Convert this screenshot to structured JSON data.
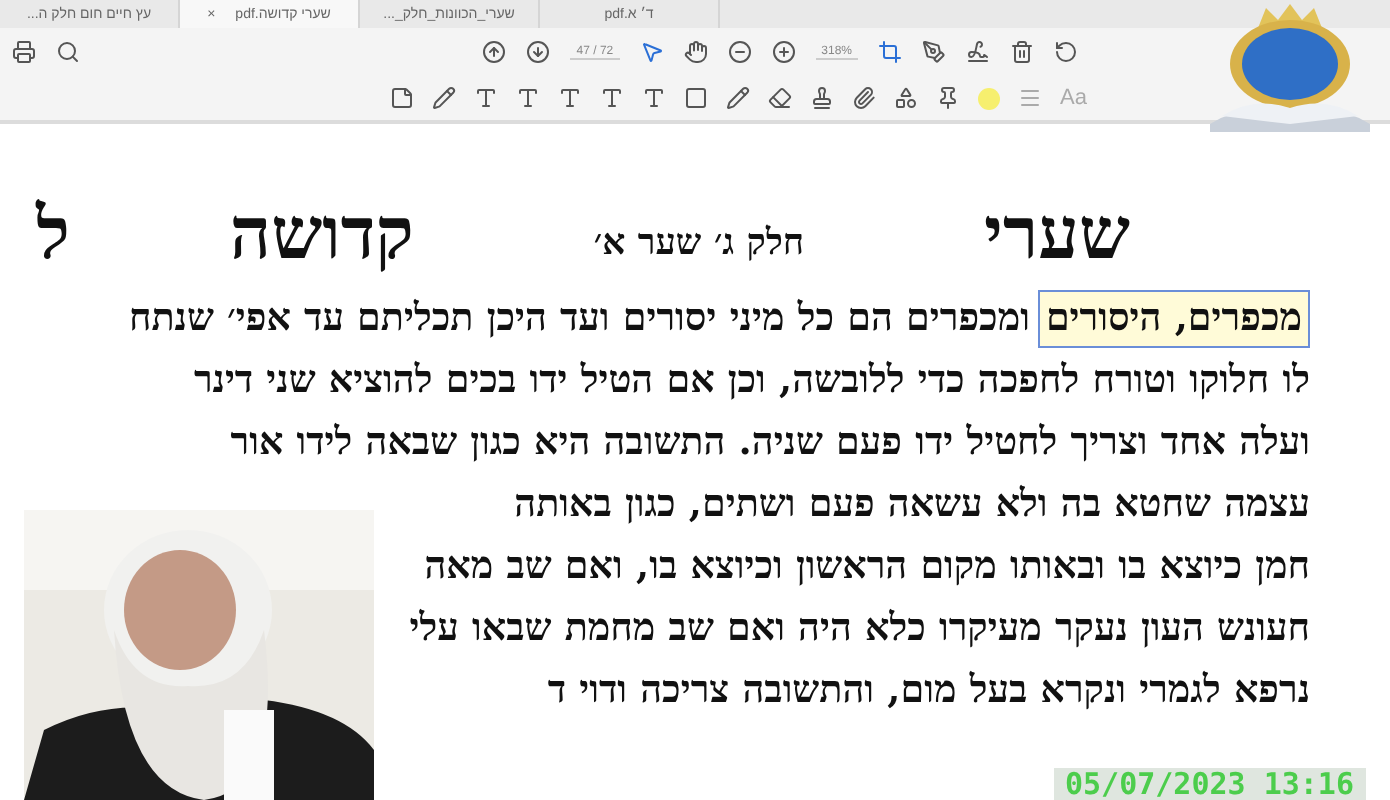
{
  "tabs": [
    {
      "label": "ד׳ א.pdf",
      "selected": false
    },
    {
      "label": "שערי_הכוונות_חלק_...",
      "selected": false
    },
    {
      "label": "שערי קדושה.pdf",
      "selected": true
    },
    {
      "label": "עץ חיים חום חלק ה...",
      "selected": false
    }
  ],
  "close_glyph": "×",
  "page": {
    "current": "47",
    "total": "/ 72"
  },
  "zoom": "318%",
  "text_style_label": "Aa",
  "heading": {
    "title_right": "שערי",
    "subtitle": "חלק ג׳ שער א׳",
    "title_left": "קדושה",
    "cut": "ל"
  },
  "highlight": "מכפרים, היסורים",
  "lines": [
    "ומכפרים הם כל מיני יסורים ועד היכן תכליתם עד אפי׳ שנתח",
    "לו חלוקו וטורח לחפכה כדי ללובשה, וכן אם הטיל ידו בכים להוציא שני דינר",
    "ועלה אחד וצריך לחטיל ידו פעם שניה. התשובה היא כגון שבאה לידו אור"
  ],
  "lines_beside_video": [
    "עצמה שחטא בה ולא עשאה פעם ושתים, כגון באותה",
    "חמן כיוצא בו ובאותו מקום הראשון וכיוצא בו, ואם שב מאה",
    "חעונש העון נעקר מעיקרו כלא היה ואם שב מחמת שבאו עלי",
    "נרפא לגמרי ונקרא בעל מום, והתשובה צריכה ודוי ד"
  ],
  "video": {
    "kind": "picture",
    "timestamp": "05/07/2023 13:16"
  }
}
